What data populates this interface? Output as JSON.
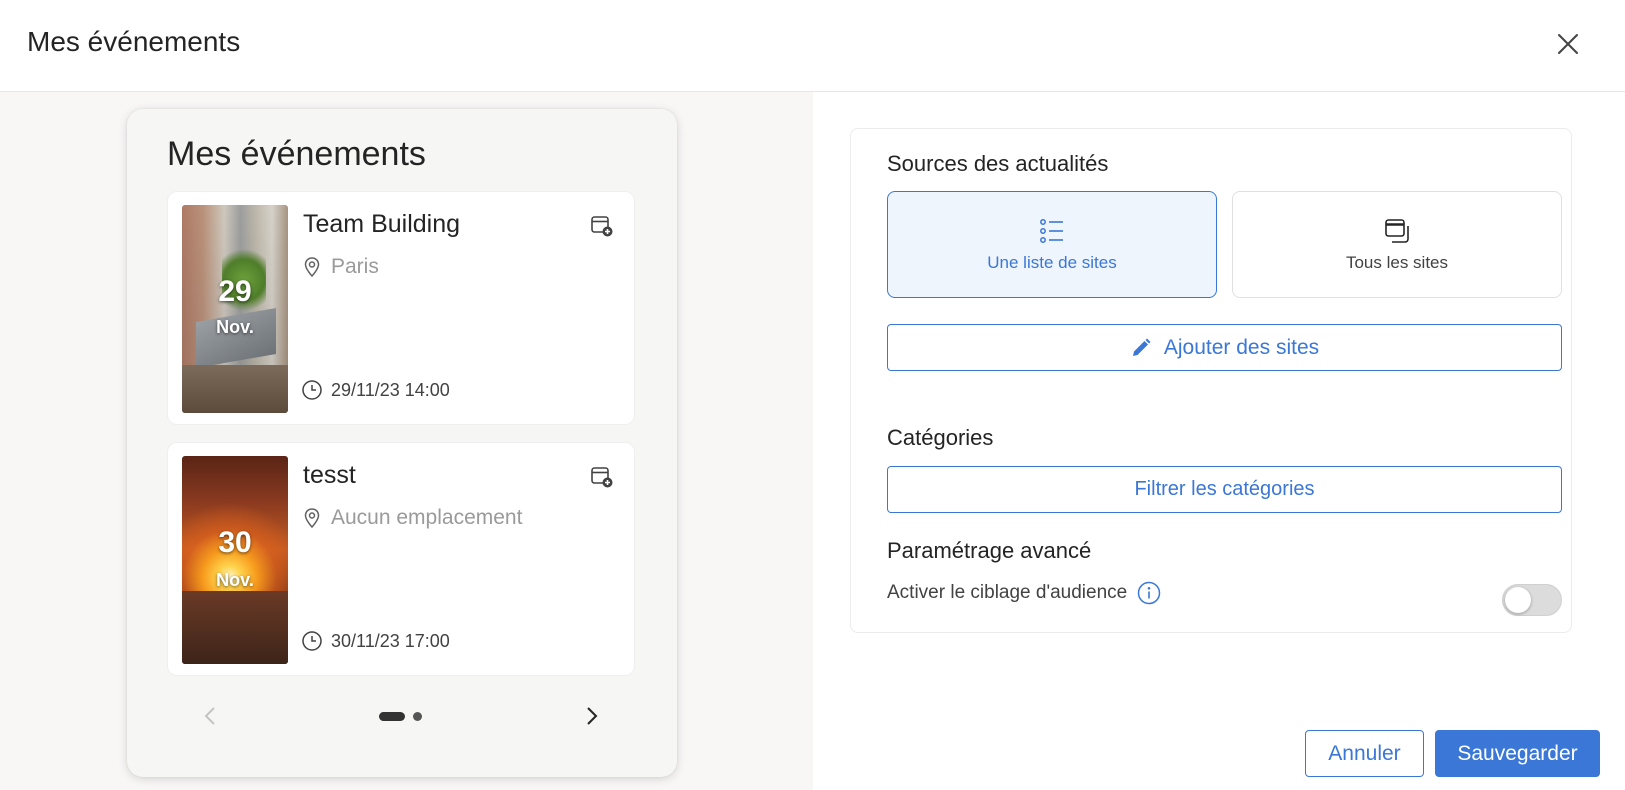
{
  "header": {
    "title": "Mes événements",
    "close_icon": "close-icon"
  },
  "preview": {
    "title": "Mes événements",
    "events": [
      {
        "title": "Team Building",
        "day": "29",
        "month": "Nov.",
        "location": "Paris",
        "datetime": "29/11/23 14:00",
        "image": "team-office-photo"
      },
      {
        "title": "tesst",
        "day": "30",
        "month": "Nov.",
        "location": "Aucun emplacement",
        "datetime": "30/11/23 17:00",
        "image": "sunset-canyon-photo"
      }
    ],
    "pager": {
      "pages": 2,
      "current": 1
    }
  },
  "settings": {
    "sources_label": "Sources des actualités",
    "sources": [
      {
        "label": "Une liste de sites",
        "icon": "list-icon",
        "selected": true
      },
      {
        "label": "Tous les sites",
        "icon": "windows-icon",
        "selected": false
      }
    ],
    "add_sites_label": "Ajouter des sites",
    "categories_label": "Catégories",
    "filter_categories_label": "Filtrer les catégories",
    "advanced_label": "Paramétrage avancé",
    "audience_label": "Activer le ciblage d'audience",
    "audience_enabled": false
  },
  "footer": {
    "cancel_label": "Annuler",
    "save_label": "Sauvegarder"
  },
  "colors": {
    "accent": "#3a77d6",
    "selected_bg": "#eff5fd",
    "left_bg": "#f8f7f6",
    "muted_text": "#9a9a9a"
  }
}
